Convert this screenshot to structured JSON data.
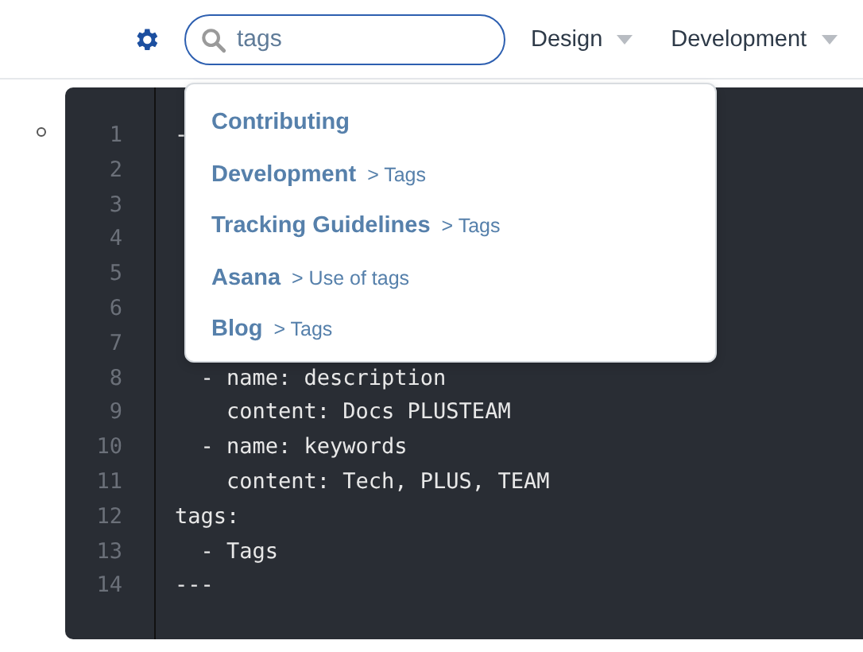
{
  "header": {
    "search": {
      "value": "tags"
    },
    "nav": [
      {
        "label": "Design"
      },
      {
        "label": "Development"
      }
    ]
  },
  "search_results": [
    {
      "title": "Contributing"
    },
    {
      "title": "Development",
      "path": "> Tags"
    },
    {
      "title": "Tracking Guidelines",
      "path": "> Tags"
    },
    {
      "title": "Asana",
      "path": "> Use of tags"
    },
    {
      "title": "Blog",
      "path": "> Tags"
    }
  ],
  "code_block": {
    "lines": [
      {
        "number": "1",
        "code": "-"
      },
      {
        "number": "2"
      },
      {
        "number": "3"
      },
      {
        "number": "4"
      },
      {
        "number": "5"
      },
      {
        "number": "6"
      },
      {
        "number": "7"
      },
      {
        "number": "8",
        "code": "  - name: description"
      },
      {
        "number": "9",
        "code": "    content: Docs PLUSTEAM"
      },
      {
        "number": "10",
        "code": "  - name: keywords"
      },
      {
        "number": "11",
        "code": "    content: Tech, PLUS, TEAM"
      },
      {
        "number": "12",
        "code": "tags:"
      },
      {
        "number": "13",
        "code": "  - Tags"
      },
      {
        "number": "14",
        "code": "---"
      }
    ]
  }
}
